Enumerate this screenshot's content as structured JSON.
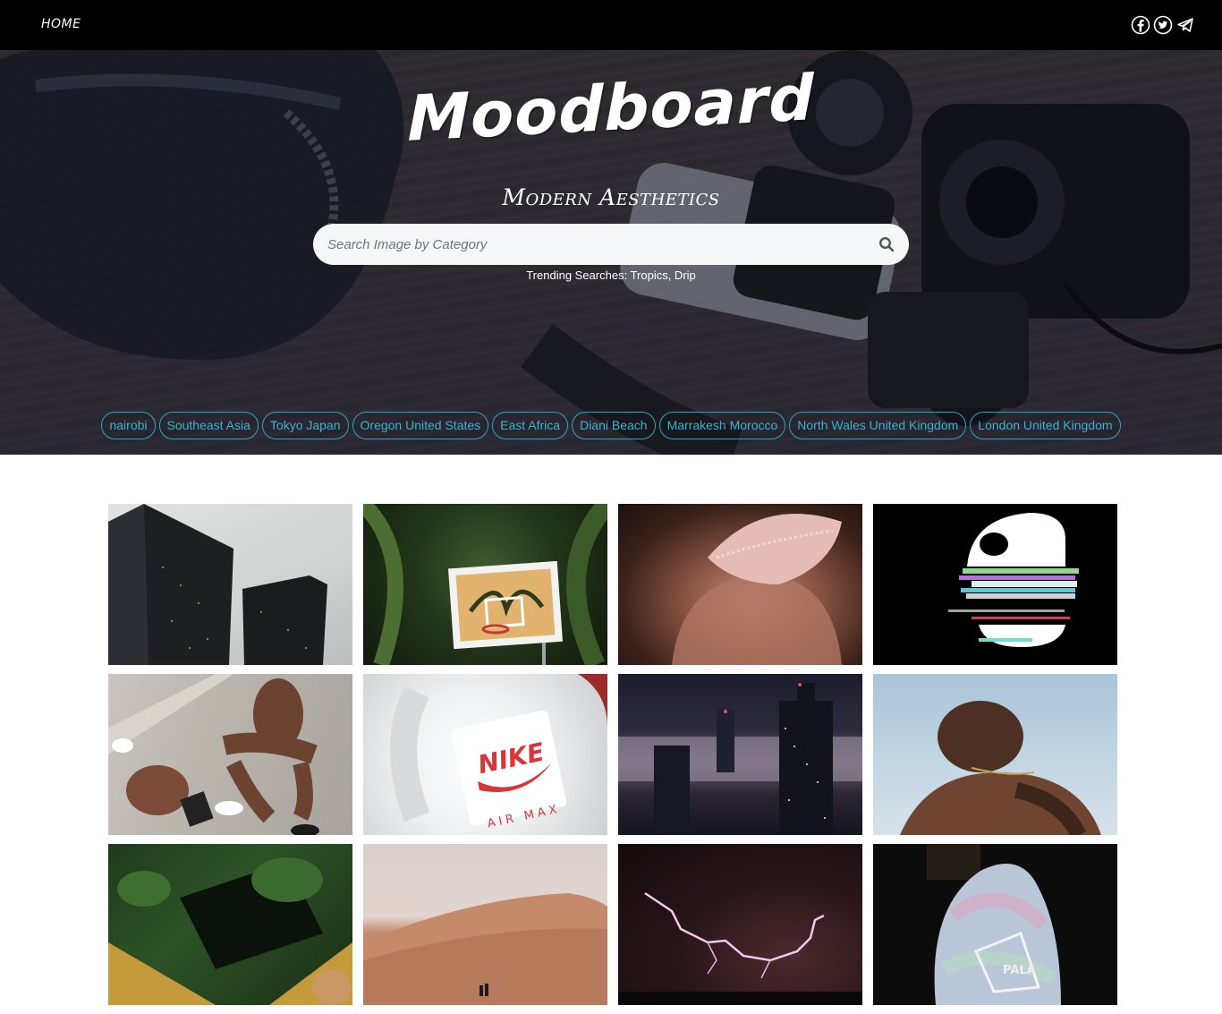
{
  "nav": {
    "home_label": "HOME",
    "social_icons": [
      "facebook-icon",
      "twitter-icon",
      "telegram-icon"
    ]
  },
  "hero": {
    "logo": "Moodboard",
    "subtitle": "Modern Aesthetics",
    "search": {
      "placeholder": "Search Image by Category",
      "value": "",
      "icon": "search-icon"
    },
    "trending_text": "Trending Searches: Tropics, Drip",
    "tags": [
      "nairobi",
      "Southeast Asia",
      "Tokyo Japan",
      "Oregon United States",
      "East Africa",
      "Diani Beach",
      "Marrakesh Morocco",
      "North Wales United Kingdom",
      "London United Kingdom"
    ],
    "accent_color": "#3cb1d0"
  },
  "gallery": {
    "photos": [
      {
        "subject": "skyscrapers"
      },
      {
        "subject": "basketball-hoop-palms"
      },
      {
        "subject": "lace-underwear"
      },
      {
        "subject": "glitch-ape-logo"
      },
      {
        "subject": "boxers-sitting"
      },
      {
        "subject": "nike-air-max-tongue"
      },
      {
        "subject": "foggy-city-night"
      },
      {
        "subject": "man-back-water-drops"
      },
      {
        "subject": "tropical-courtyard"
      },
      {
        "subject": "desert-dunes"
      },
      {
        "subject": "lightning-storm"
      },
      {
        "subject": "palace-jacket"
      }
    ]
  }
}
